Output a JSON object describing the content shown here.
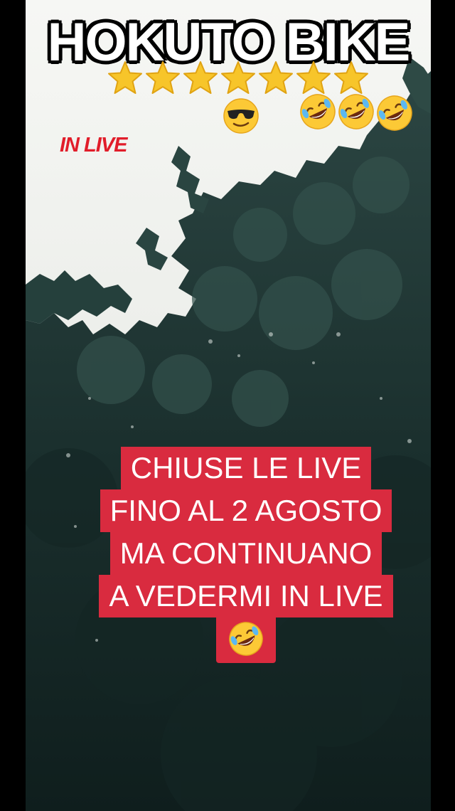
{
  "video": {
    "title": "HOKUTO BIKE",
    "rating_stars": 7,
    "tag": "IN LIVE",
    "top_emojis": [
      "cool-sunglasses-emoji",
      "rolling-laughing-emoji",
      "rolling-laughing-emoji",
      "rolling-laughing-emoji"
    ],
    "caption": {
      "line1": "CHIUSE LE LIVE",
      "line2": "FINO AL 2 AGOSTO",
      "line3": "MA CONTINUANO",
      "line4": "A VEDERMI IN LIVE",
      "emoji": "rolling-laughing-emoji"
    }
  },
  "colors": {
    "caption_bg": "#d92b3f",
    "tag_text": "#e11d2a",
    "title_text": "#ffffff",
    "title_outline": "#000000",
    "foliage": "#1d3331"
  }
}
